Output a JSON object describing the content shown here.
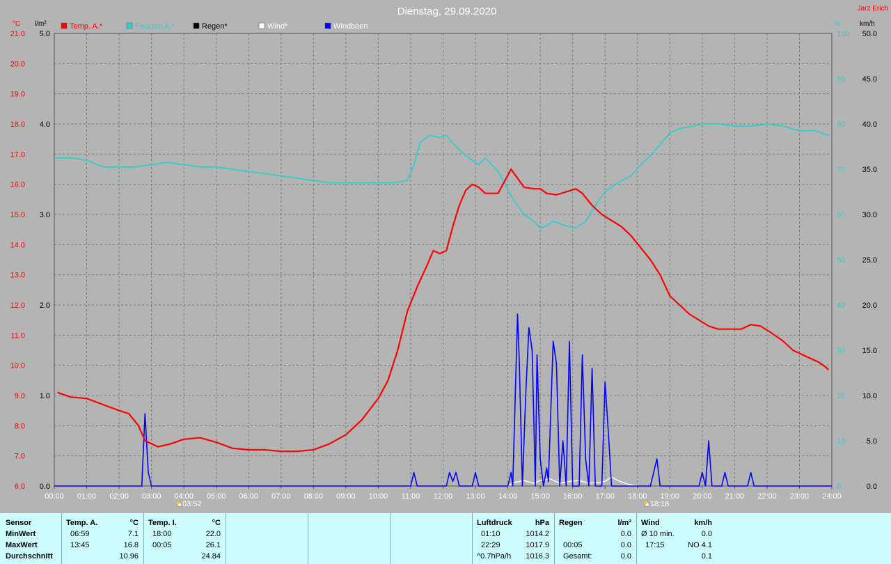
{
  "title": "Dienstag, 29.09.2020",
  "author": "Jarz Erich",
  "colors": {
    "background": "#b4b4b4",
    "temp": "#ff0000",
    "humidity": "#33cccc",
    "rain": "#000000",
    "wind": "#ffffff",
    "gust": "#0000ff",
    "table_bg": "#cdfcff"
  },
  "legend": [
    {
      "label": "Temp. A.*",
      "color": "#ff0000"
    },
    {
      "label": "Feuchte A.*",
      "color": "#33cccc"
    },
    {
      "label": "Regen*",
      "color": "#000000"
    },
    {
      "label": "Wind*",
      "color": "#ffffff"
    },
    {
      "label": "Windböen",
      "color": "#0000ff"
    }
  ],
  "axes": {
    "left_temp_unit": "°C",
    "left_rain_unit": "l/m²",
    "right_hum_unit": "%",
    "right_wind_unit": "km/h",
    "temp_ticks": [
      "21.0",
      "20.0",
      "19.0",
      "18.0",
      "17.0",
      "16.0",
      "15.0",
      "14.0",
      "13.0",
      "12.0",
      "11.0",
      "10.0",
      "9.0",
      "8.0",
      "7.0",
      "6.0"
    ],
    "rain_ticks": [
      "5.0",
      "4.0",
      "3.0",
      "2.0",
      "1.0",
      "0.0"
    ],
    "hum_ticks": [
      "100",
      "90",
      "80",
      "70",
      "60",
      "50",
      "40",
      "30",
      "20",
      "10",
      "0"
    ],
    "wind_ticks": [
      "50.0",
      "45.0",
      "40.0",
      "35.0",
      "30.0",
      "25.0",
      "20.0",
      "15.0",
      "10.0",
      "5.0",
      "0.0"
    ],
    "x_ticks": [
      "00:00",
      "01:00",
      "02:00",
      "03:00",
      "04:00",
      "05:00",
      "06:00",
      "07:00",
      "08:00",
      "09:00",
      "10:00",
      "11:00",
      "12:00",
      "13:00",
      "14:00",
      "15:00",
      "16:00",
      "17:00",
      "18:00",
      "19:00",
      "20:00",
      "21:00",
      "22:00",
      "23:00",
      "24:00"
    ]
  },
  "sun": {
    "sunrise": "03:52",
    "sunset": "18:18"
  },
  "chart_data": {
    "type": "line",
    "x_unit": "hours",
    "xlim": [
      0,
      24
    ],
    "grid": true,
    "series": [
      {
        "name": "Temp. A.*",
        "axis": "temp",
        "ylim": [
          6,
          21
        ],
        "points": [
          [
            0.1,
            9.1
          ],
          [
            0.5,
            8.95
          ],
          [
            1,
            8.9
          ],
          [
            1.5,
            8.7
          ],
          [
            2,
            8.5
          ],
          [
            2.3,
            8.4
          ],
          [
            2.6,
            8.0
          ],
          [
            2.8,
            7.5
          ],
          [
            3.0,
            7.4
          ],
          [
            3.2,
            7.3
          ],
          [
            3.6,
            7.4
          ],
          [
            4.0,
            7.55
          ],
          [
            4.5,
            7.6
          ],
          [
            5.0,
            7.45
          ],
          [
            5.5,
            7.25
          ],
          [
            6.0,
            7.2
          ],
          [
            6.5,
            7.2
          ],
          [
            7.0,
            7.15
          ],
          [
            7.5,
            7.15
          ],
          [
            8.0,
            7.2
          ],
          [
            8.5,
            7.4
          ],
          [
            9.0,
            7.7
          ],
          [
            9.5,
            8.2
          ],
          [
            10.0,
            8.9
          ],
          [
            10.3,
            9.5
          ],
          [
            10.6,
            10.5
          ],
          [
            10.9,
            11.8
          ],
          [
            11.2,
            12.6
          ],
          [
            11.5,
            13.3
          ],
          [
            11.7,
            13.8
          ],
          [
            11.9,
            13.7
          ],
          [
            12.1,
            13.8
          ],
          [
            12.3,
            14.6
          ],
          [
            12.5,
            15.3
          ],
          [
            12.7,
            15.8
          ],
          [
            12.9,
            16.0
          ],
          [
            13.1,
            15.9
          ],
          [
            13.3,
            15.7
          ],
          [
            13.7,
            15.7
          ],
          [
            13.9,
            16.1
          ],
          [
            14.1,
            16.5
          ],
          [
            14.3,
            16.2
          ],
          [
            14.5,
            15.9
          ],
          [
            14.8,
            15.85
          ],
          [
            15.0,
            15.85
          ],
          [
            15.2,
            15.7
          ],
          [
            15.5,
            15.65
          ],
          [
            15.8,
            15.75
          ],
          [
            16.1,
            15.85
          ],
          [
            16.3,
            15.7
          ],
          [
            16.6,
            15.3
          ],
          [
            16.9,
            15.0
          ],
          [
            17.2,
            14.8
          ],
          [
            17.5,
            14.6
          ],
          [
            17.8,
            14.3
          ],
          [
            18.1,
            13.9
          ],
          [
            18.4,
            13.5
          ],
          [
            18.7,
            13.0
          ],
          [
            19.0,
            12.3
          ],
          [
            19.3,
            12.0
          ],
          [
            19.6,
            11.7
          ],
          [
            19.9,
            11.5
          ],
          [
            20.2,
            11.3
          ],
          [
            20.5,
            11.2
          ],
          [
            20.8,
            11.2
          ],
          [
            21.2,
            11.2
          ],
          [
            21.5,
            11.35
          ],
          [
            21.8,
            11.3
          ],
          [
            22.1,
            11.1
          ],
          [
            22.5,
            10.8
          ],
          [
            22.8,
            10.5
          ],
          [
            23.2,
            10.3
          ],
          [
            23.6,
            10.1
          ],
          [
            23.8,
            9.95
          ],
          [
            23.9,
            9.85
          ]
        ]
      },
      {
        "name": "Feuchte A.*",
        "axis": "hum",
        "ylim": [
          0,
          100
        ],
        "points": [
          [
            0,
            72.5
          ],
          [
            0.5,
            72.5
          ],
          [
            1,
            72
          ],
          [
            1.5,
            70.5
          ],
          [
            2,
            70.5
          ],
          [
            2.5,
            70.5
          ],
          [
            3,
            71
          ],
          [
            3.5,
            71.5
          ],
          [
            4,
            71
          ],
          [
            4.5,
            70.5
          ],
          [
            5,
            70.5
          ],
          [
            5.5,
            70
          ],
          [
            6,
            69.5
          ],
          [
            6.5,
            69
          ],
          [
            7,
            68.5
          ],
          [
            7.5,
            68
          ],
          [
            8,
            67.5
          ],
          [
            8.5,
            67
          ],
          [
            9,
            67
          ],
          [
            9.5,
            67
          ],
          [
            10,
            67
          ],
          [
            10.5,
            67
          ],
          [
            10.9,
            67.5
          ],
          [
            11.1,
            71
          ],
          [
            11.3,
            76
          ],
          [
            11.6,
            77.5
          ],
          [
            11.9,
            77
          ],
          [
            12.1,
            77.5
          ],
          [
            12.4,
            75
          ],
          [
            12.7,
            73
          ],
          [
            12.9,
            72
          ],
          [
            13.1,
            71
          ],
          [
            13.3,
            72.5
          ],
          [
            13.5,
            71
          ],
          [
            13.7,
            69.5
          ],
          [
            13.9,
            67
          ],
          [
            14.1,
            64
          ],
          [
            14.3,
            62
          ],
          [
            14.5,
            60
          ],
          [
            14.8,
            58.5
          ],
          [
            15.0,
            57
          ],
          [
            15.2,
            57.5
          ],
          [
            15.4,
            58.5
          ],
          [
            15.6,
            58
          ],
          [
            15.8,
            57.5
          ],
          [
            16.1,
            57
          ],
          [
            16.4,
            58.5
          ],
          [
            16.7,
            62
          ],
          [
            17.0,
            65
          ],
          [
            17.4,
            67
          ],
          [
            17.8,
            68.5
          ],
          [
            18.1,
            71
          ],
          [
            18.4,
            73
          ],
          [
            18.7,
            75.5
          ],
          [
            19.0,
            78
          ],
          [
            19.3,
            79
          ],
          [
            19.7,
            79.5
          ],
          [
            20.0,
            80
          ],
          [
            20.5,
            80
          ],
          [
            21,
            79.5
          ],
          [
            21.5,
            79.5
          ],
          [
            22,
            80
          ],
          [
            22.5,
            79.5
          ],
          [
            23,
            78.5
          ],
          [
            23.5,
            78.5
          ],
          [
            23.9,
            77.5
          ]
        ]
      },
      {
        "name": "Windböen",
        "axis": "wind",
        "ylim": [
          0,
          50
        ],
        "points": [
          [
            0,
            0
          ],
          [
            2.7,
            0
          ],
          [
            2.8,
            8
          ],
          [
            2.9,
            1.5
          ],
          [
            3.0,
            0
          ],
          [
            11.0,
            0
          ],
          [
            11.1,
            1.5
          ],
          [
            11.2,
            0
          ],
          [
            12.1,
            0
          ],
          [
            12.2,
            1.5
          ],
          [
            12.3,
            0.5
          ],
          [
            12.4,
            1.5
          ],
          [
            12.5,
            0
          ],
          [
            12.9,
            0
          ],
          [
            13.0,
            1.5
          ],
          [
            13.1,
            0
          ],
          [
            14.0,
            0
          ],
          [
            14.1,
            1.5
          ],
          [
            14.15,
            0
          ],
          [
            14.3,
            19
          ],
          [
            14.35,
            14
          ],
          [
            14.45,
            0
          ],
          [
            14.55,
            10
          ],
          [
            14.65,
            17.5
          ],
          [
            14.75,
            15
          ],
          [
            14.85,
            0
          ],
          [
            14.9,
            14.5
          ],
          [
            15.0,
            3
          ],
          [
            15.1,
            0
          ],
          [
            15.2,
            2
          ],
          [
            15.25,
            0.5
          ],
          [
            15.4,
            16
          ],
          [
            15.5,
            13.5
          ],
          [
            15.6,
            0
          ],
          [
            15.7,
            5
          ],
          [
            15.8,
            0
          ],
          [
            15.9,
            16
          ],
          [
            16.0,
            0
          ],
          [
            16.2,
            0
          ],
          [
            16.3,
            14.5
          ],
          [
            16.4,
            3
          ],
          [
            16.5,
            0
          ],
          [
            16.6,
            13
          ],
          [
            16.7,
            0
          ],
          [
            16.9,
            0
          ],
          [
            17.0,
            11.5
          ],
          [
            17.1,
            6
          ],
          [
            17.2,
            0
          ],
          [
            18.4,
            0
          ],
          [
            18.6,
            3
          ],
          [
            18.7,
            0
          ],
          [
            19.9,
            0
          ],
          [
            20.0,
            1.5
          ],
          [
            20.1,
            0
          ],
          [
            20.2,
            5
          ],
          [
            20.3,
            0
          ],
          [
            20.6,
            0
          ],
          [
            20.7,
            1.5
          ],
          [
            20.8,
            0
          ],
          [
            21.4,
            0
          ],
          [
            21.5,
            1.5
          ],
          [
            21.6,
            0
          ],
          [
            24,
            0
          ]
        ]
      },
      {
        "name": "Wind*",
        "axis": "wind",
        "ylim": [
          0,
          50
        ],
        "points": [
          [
            14.0,
            0
          ],
          [
            14.2,
            0.4
          ],
          [
            14.5,
            0.6
          ],
          [
            14.8,
            0.3
          ],
          [
            15.0,
            0.6
          ],
          [
            15.3,
            0.8
          ],
          [
            15.6,
            0.3
          ],
          [
            15.9,
            0.5
          ],
          [
            16.2,
            0.6
          ],
          [
            16.5,
            0.3
          ],
          [
            16.8,
            0.4
          ],
          [
            17.0,
            0.5
          ],
          [
            17.2,
            1.0
          ],
          [
            17.4,
            0.6
          ],
          [
            17.7,
            0.2
          ],
          [
            18.0,
            0
          ]
        ]
      }
    ],
    "rain_series": {
      "name": "Regen*",
      "axis": "rain",
      "ylim": [
        0,
        5
      ],
      "values": "0.0"
    }
  },
  "table": {
    "cols": [
      {
        "rows": [
          [
            "Sensor",
            "",
            ""
          ],
          [
            "MinWert",
            "",
            ""
          ],
          [
            "MaxWert",
            "",
            ""
          ],
          [
            "Durchschnitt",
            "",
            ""
          ]
        ]
      },
      {
        "header": [
          "Temp. A.",
          "°C"
        ],
        "rows": [
          [
            "06:59",
            "7.1"
          ],
          [
            "13:45",
            "16.8"
          ],
          [
            "",
            "10.96"
          ]
        ]
      },
      {
        "header": [
          "Temp. I.",
          "°C"
        ],
        "rows": [
          [
            "18:00",
            "22.0"
          ],
          [
            "00:05",
            "26.1"
          ],
          [
            "",
            "24.84"
          ]
        ]
      },
      {
        "header": [
          "Luftdruck",
          "hPa"
        ],
        "rows": [
          [
            "01:10",
            "1014.2"
          ],
          [
            "22:29",
            "1017.9"
          ],
          [
            "^0.7hPa/h",
            "1016.3"
          ]
        ]
      },
      {
        "header": [
          "Regen",
          "l/m²"
        ],
        "rows": [
          [
            "",
            "0.0"
          ],
          [
            "00:05",
            "0.0"
          ],
          [
            "Gesamt:",
            "0.0"
          ]
        ]
      },
      {
        "header": [
          "Wind",
          "km/h"
        ],
        "rows": [
          [
            "Ø 10 min.",
            "0.0"
          ],
          [
            "17:15",
            "NO 4.1"
          ],
          [
            "",
            "0.1"
          ]
        ]
      }
    ]
  }
}
